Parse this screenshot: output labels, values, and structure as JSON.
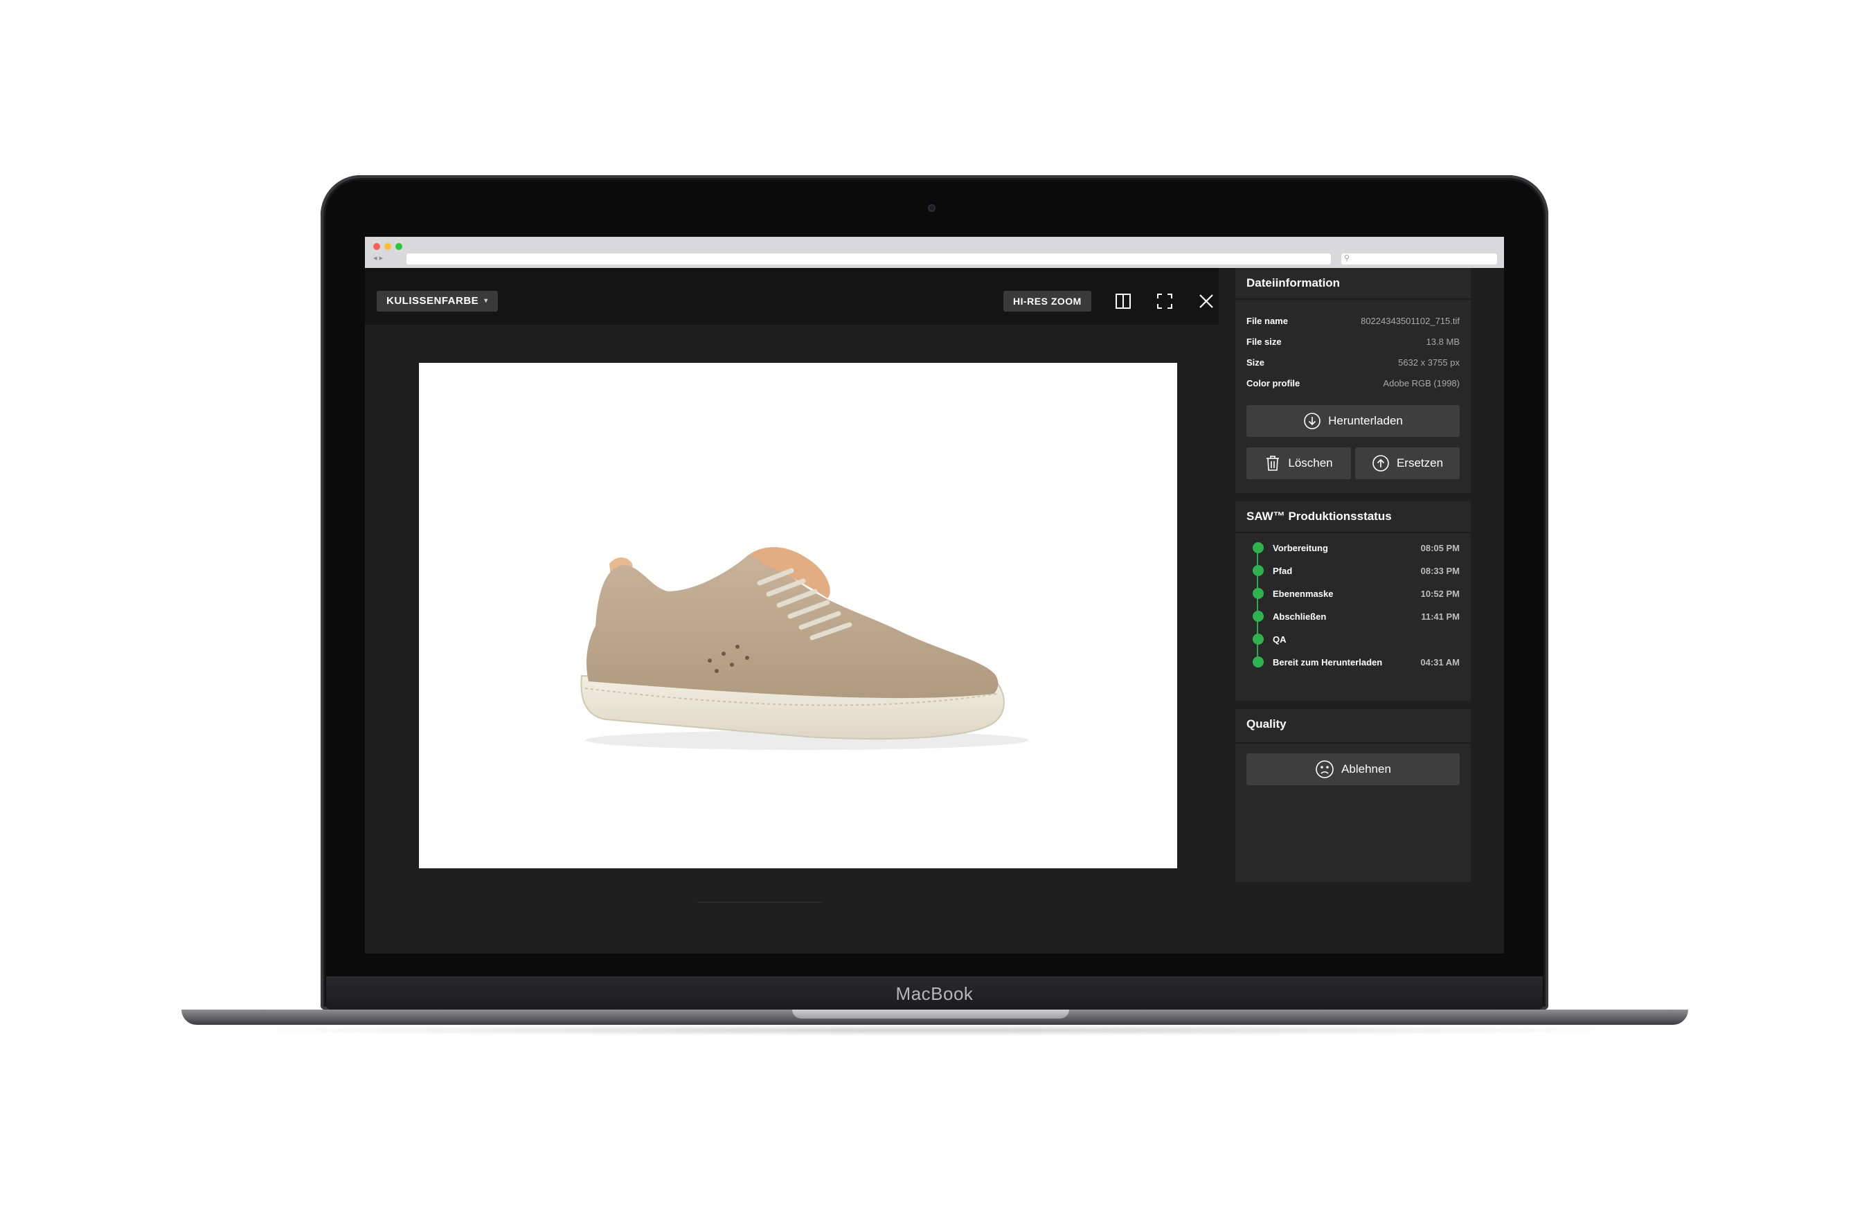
{
  "device": {
    "label": "MacBook"
  },
  "toolbar": {
    "backdrop_label": "KULISSENFARBE",
    "hires_label": "HI-RES ZOOM",
    "compare_icon": "split-view-icon",
    "fullscreen_icon": "fullscreen-icon",
    "close_icon": "close-icon"
  },
  "viewer": {
    "image_subject": "beige suede sneaker"
  },
  "file_info": {
    "title": "Dateiinformation",
    "rows": [
      {
        "label": "File name",
        "value": "80224343501102_715.tif"
      },
      {
        "label": "File size",
        "value": "13.8 MB"
      },
      {
        "label": "Size",
        "value": "5632 x 3755 px"
      },
      {
        "label": "Color profile",
        "value": "Adobe RGB (1998)"
      }
    ],
    "download_label": "Herunterladen",
    "delete_label": "Löschen",
    "replace_label": "Ersetzen"
  },
  "production": {
    "title": "SAW™ Produktionsstatus",
    "steps": [
      {
        "label": "Vorbereitung",
        "time": "08:05 PM"
      },
      {
        "label": "Pfad",
        "time": "08:33 PM"
      },
      {
        "label": "Ebenenmaske",
        "time": "10:52 PM"
      },
      {
        "label": "Abschließen",
        "time": "11:41 PM"
      },
      {
        "label": "QA",
        "time": ""
      },
      {
        "label": "Bereit zum Herunterladen",
        "time": "04:31 AM"
      }
    ],
    "status_color": "#2fb34f"
  },
  "quality": {
    "title": "Quality",
    "reject_label": "Ablehnen"
  }
}
